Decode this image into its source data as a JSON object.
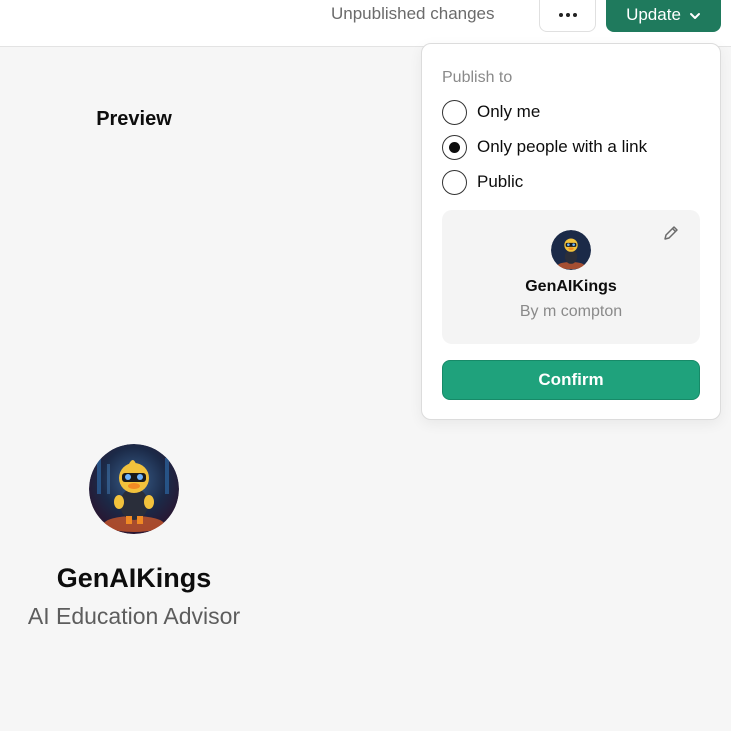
{
  "header": {
    "status_text": "Unpublished changes",
    "more_icon": "more-horizontal-icon",
    "update_label": "Update",
    "update_icon": "chevron-down-icon",
    "accent_color": "#1f7a5d"
  },
  "preview": {
    "title": "Preview",
    "gpt_name": "GenAIKings",
    "gpt_description": "AI Education Advisor",
    "avatar_icon": "duck-character-avatar"
  },
  "publish_popover": {
    "label": "Publish to",
    "options": [
      {
        "label": "Only me",
        "selected": false
      },
      {
        "label": "Only people with a link",
        "selected": true
      },
      {
        "label": "Public",
        "selected": false
      }
    ],
    "card": {
      "name": "GenAIKings",
      "author": "By m compton",
      "edit_icon": "pencil-icon"
    },
    "confirm_label": "Confirm",
    "confirm_color": "#1fa27c"
  }
}
